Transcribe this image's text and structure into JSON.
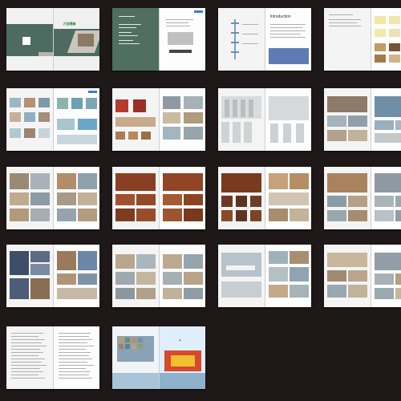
{
  "catalog": {
    "brand_text": "力佳德森",
    "intro_heading": "Introduction",
    "spreads": [
      {
        "id": 1,
        "kind": "cover"
      },
      {
        "id": 2,
        "kind": "contents"
      },
      {
        "id": 3,
        "kind": "introduction"
      },
      {
        "id": 4,
        "kind": "swatches"
      },
      {
        "id": 5,
        "kind": "school-furniture"
      },
      {
        "id": 6,
        "kind": "auditorium-chairs"
      },
      {
        "id": 7,
        "kind": "compact-shelving"
      },
      {
        "id": 8,
        "kind": "library"
      },
      {
        "id": 9,
        "kind": "dormitory"
      },
      {
        "id": 10,
        "kind": "office-desks"
      },
      {
        "id": 11,
        "kind": "conference"
      },
      {
        "id": 12,
        "kind": "workstations"
      },
      {
        "id": 13,
        "kind": "apartment"
      },
      {
        "id": 14,
        "kind": "lab-furniture"
      },
      {
        "id": 15,
        "kind": "classroom"
      },
      {
        "id": 16,
        "kind": "canteen"
      },
      {
        "id": 17,
        "kind": "index"
      },
      {
        "id": 18,
        "kind": "back-cover"
      }
    ]
  }
}
